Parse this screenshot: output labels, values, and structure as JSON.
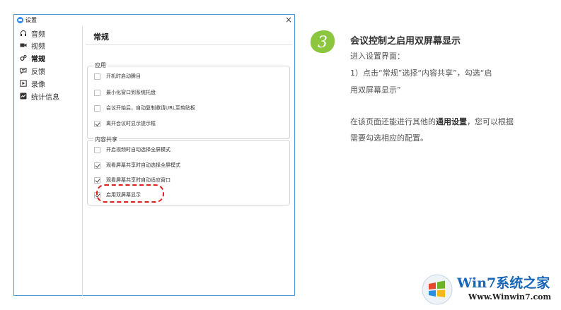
{
  "window": {
    "title": "设置",
    "close_glyph": "×",
    "accent": "#2d8cf0"
  },
  "sidebar": {
    "items": [
      {
        "label": "音频",
        "icon": "headphone-icon"
      },
      {
        "label": "视频",
        "icon": "video-camera-icon"
      },
      {
        "label": "常规",
        "icon": "gear-icon",
        "active": true
      },
      {
        "label": "反馈",
        "icon": "chat-icon"
      },
      {
        "label": "录像",
        "icon": "record-icon"
      },
      {
        "label": "统计信息",
        "icon": "stats-icon"
      }
    ]
  },
  "main": {
    "title": "常规",
    "app_group": {
      "title": "应用",
      "options": [
        {
          "label": "开机时启动腾目",
          "checked": false
        },
        {
          "label": "最小化窗口到系统托盘",
          "checked": false
        },
        {
          "label": "会议开始后，自动复制邀请URL至剪贴板",
          "checked": false
        },
        {
          "label": "离开会议时显示提示框",
          "checked": true
        }
      ]
    },
    "share_group": {
      "title": "内容共享",
      "options": [
        {
          "label": "开启视频时自动选择全屏模式",
          "checked": false
        },
        {
          "label": "观看屏幕共享时自动选择全屏模式",
          "checked": true
        },
        {
          "label": "观看屏幕共享时自动适应窗口",
          "checked": true
        },
        {
          "label": "启用双屏幕显示",
          "checked": true
        }
      ]
    },
    "highlight_color": "#e02020"
  },
  "tutorial": {
    "step_number": "3",
    "step_color": "#8cc63f",
    "title": "会议控制之启用双屏幕显示",
    "line1": "进入设置界面：",
    "line2": "1）点击“常规”选择“内容共享”，勾选“启",
    "line3": "用双屏幕显示”",
    "line4_pre": "在该页面还能进行其他的",
    "line4_bold": "通用设置",
    "line4_post": "，您可以根据",
    "line5": "需要勾选相应的配置。"
  },
  "watermark": {
    "brand": "Win7系统之家",
    "url": "Www.Winwin7.com"
  }
}
